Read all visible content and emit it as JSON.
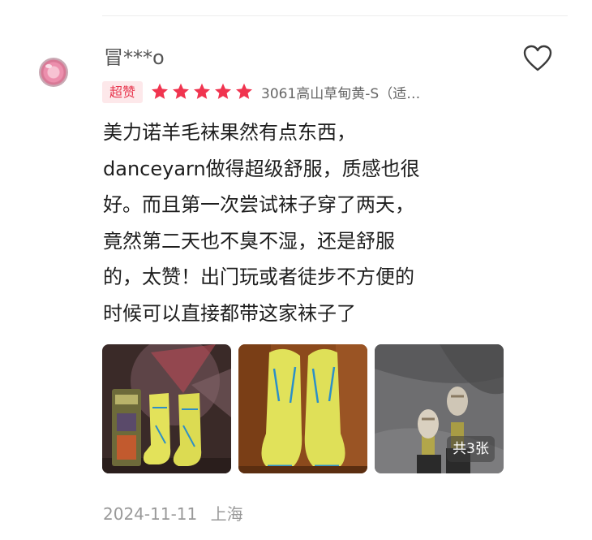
{
  "review": {
    "username": "冒***o",
    "badge": "超赞",
    "rating": 5,
    "rating_max": 5,
    "sku": "3061高山草甸黄-S（适…",
    "text": "美力诺羊毛袜果然有点东西，danceyarn做得超级舒服，质感也很好。而且第一次尝试袜子穿了两天，竟然第二天也不臭不湿，还是舒服的，太赞！出门玩或者徒步不方便的时候可以直接都带这家袜子了",
    "text_lines": [
      "美力诺羊毛袜果然有点东西，",
      "danceyarn做得超级舒服，质感也很",
      "好。而且第一次尝试袜子穿了两天，",
      "竟然第二天也不臭不湿，还是舒服",
      "的，太赞！出门玩或者徒步不方便的",
      "时候可以直接都带这家袜子了"
    ],
    "photos_count_label": "共3张",
    "date": "2024-11-11",
    "location": "上海"
  },
  "icons": {
    "like": "heart-outline-icon",
    "star": "star-filled-icon"
  },
  "colors": {
    "badge_bg": "#fde8ea",
    "badge_text": "#e8374f",
    "star": "#f0344f",
    "meta_text": "#999999"
  }
}
